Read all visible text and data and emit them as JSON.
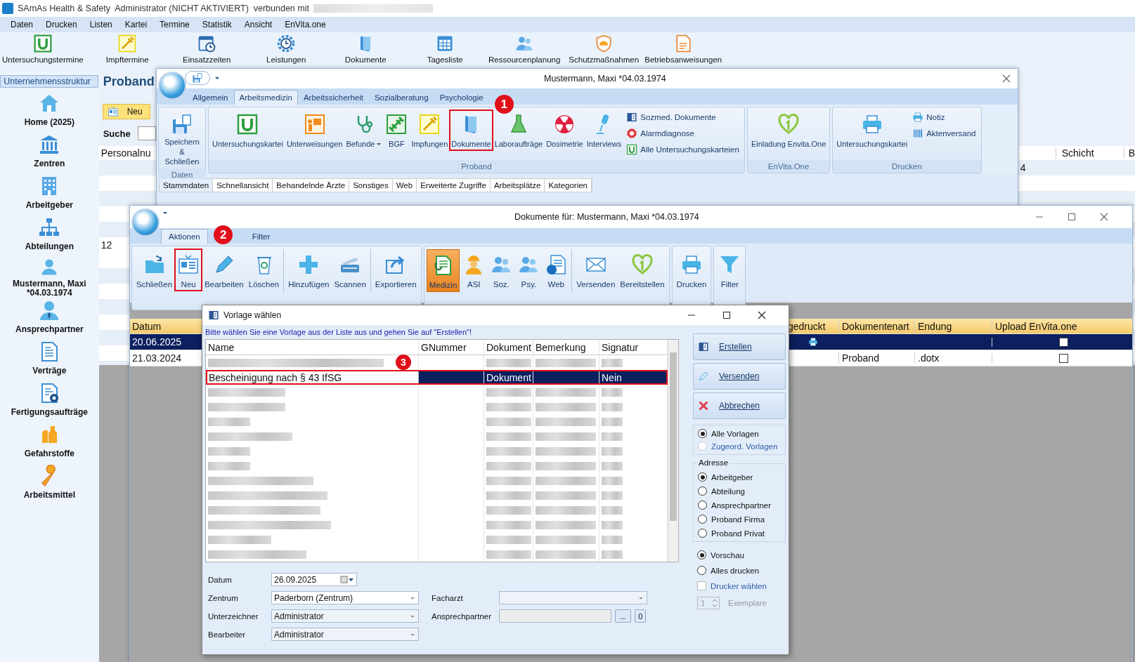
{
  "app": {
    "title": "SAmAs Health & Safety  Administrator (NICHT AKTIVIERT)  verbunden mit",
    "menu": [
      "Daten",
      "Drucken",
      "Listen",
      "Kartei",
      "Termine",
      "Statistik",
      "Ansicht",
      "EnVita.one"
    ],
    "toolbar": [
      "Untersuchungstermine",
      "Impftermine",
      "Einsatzzeiten",
      "Leistungen",
      "Dokumente",
      "Tagesliste",
      "Ressourcenplanung",
      "Schutzmaßnahmen",
      "Betriebsanweisungen"
    ]
  },
  "sidebar": {
    "header": "Unternehmensstruktur",
    "items": [
      "Home (2025)",
      "Zentren",
      "Arbeitgeber",
      "Abteilungen",
      "Mustermann, Maxi *04.03.1974",
      "Ansprechpartner",
      "Verträge",
      "Fertigungsaufträge",
      "Gefahrstoffe",
      "Arbeitsmittel"
    ]
  },
  "proband": {
    "title": "Proband",
    "new_button": "Neu",
    "search_label": "Suche",
    "columns": [
      "Personalnu",
      "Schicht",
      "B"
    ],
    "rows": [
      {
        "column_3": "4"
      },
      {},
      {},
      {},
      {},
      {
        "personalnummer": "12"
      }
    ]
  },
  "window1": {
    "title": "Mustermann, Maxi *04.03.1974",
    "tabs": [
      {
        "label": "Allgemein",
        "selected": false
      },
      {
        "label": "Arbeitsmedizin",
        "selected": true
      },
      {
        "label": "Arbeitssicherheit",
        "selected": false
      },
      {
        "label": "Sozialberatung",
        "selected": false
      },
      {
        "label": "Psychologie",
        "selected": false
      }
    ],
    "groups": [
      {
        "label": "Daten",
        "items": [
          {
            "label": "Speichern & Schließen",
            "kind": "large",
            "marked": false
          }
        ]
      },
      {
        "label": "Proband",
        "items": [
          {
            "label": "Untersuchungskartei",
            "kind": "large",
            "marked": false
          },
          {
            "label": "Unterweisungen",
            "kind": "large",
            "marked": false
          },
          {
            "label": "Befunde",
            "kind": "dropdown",
            "marked": false
          },
          {
            "label": "BGF",
            "kind": "large",
            "marked": false
          },
          {
            "label": "Impfungen",
            "kind": "large",
            "marked": false
          },
          {
            "label": "Dokumente",
            "kind": "large",
            "marked": true,
            "callout": "1"
          },
          {
            "label": "Laboraufträge",
            "kind": "large",
            "marked": false
          },
          {
            "label": "Dosimetrie",
            "kind": "large",
            "marked": false
          },
          {
            "label": "Interviews",
            "kind": "large",
            "marked": false
          },
          {
            "label": "Sozmed. Dokumente",
            "kind": "small",
            "marked": false
          },
          {
            "label": "Alarmdiagnose",
            "kind": "small",
            "marked": false
          },
          {
            "label": "Alle Untersuchungskarteien",
            "kind": "small",
            "marked": false
          }
        ]
      },
      {
        "label": "EnVita.One",
        "items": [
          {
            "label": "Einladung Envita.One",
            "kind": "large",
            "marked": false
          }
        ]
      },
      {
        "label": "Drucken",
        "items": [
          {
            "label": "Untersuchungskartei",
            "kind": "large",
            "marked": false
          },
          {
            "label": "Notiz",
            "kind": "small",
            "marked": false
          },
          {
            "label": "Aktenversand",
            "kind": "small",
            "marked": false
          }
        ]
      }
    ],
    "subtabs": [
      {
        "label": "Stammdaten",
        "selected": true
      },
      {
        "label": "Schnellansicht",
        "selected": false
      },
      {
        "label": "Behandelnde Ärzte",
        "selected": false
      },
      {
        "label": "Sonstiges",
        "selected": false
      },
      {
        "label": "Web",
        "selected": false
      },
      {
        "label": "Erweiterte Zugriffe",
        "selected": false
      },
      {
        "label": "Arbeitsplätze",
        "selected": false
      },
      {
        "label": "Kategorien",
        "selected": false
      }
    ]
  },
  "window2": {
    "title": "Dokumente für: Mustermann, Maxi *04.03.1974",
    "tabs": [
      {
        "label": "Aktionen",
        "selected": true
      },
      {
        "label": "Filter",
        "selected": false
      }
    ],
    "ribbon": [
      {
        "sections": [
          [
            {
              "label": "Schließen",
              "selected": false,
              "marked": false
            },
            {
              "label": "Neu",
              "selected": false,
              "marked": true,
              "callout": "2"
            },
            {
              "label": "Bearbeiten",
              "selected": false,
              "marked": false
            },
            {
              "label": "Löschen",
              "selected": false,
              "marked": false
            }
          ],
          [
            {
              "label": "Hinzufügen",
              "selected": false,
              "marked": false
            },
            {
              "label": "Scannen",
              "selected": false,
              "marked": false
            }
          ],
          [
            {
              "label": "Exportieren",
              "selected": false,
              "marked": false
            }
          ]
        ]
      },
      {
        "sections": [
          [
            {
              "label": "Medizin",
              "selected": true,
              "marked": false
            },
            {
              "label": "ASI",
              "selected": false,
              "marked": false
            },
            {
              "label": "Soz.",
              "selected": false,
              "marked": false
            },
            {
              "label": "Psy.",
              "selected": false,
              "marked": false
            },
            {
              "label": "Web",
              "selected": false,
              "marked": false
            }
          ],
          [
            {
              "label": "Versenden",
              "selected": false,
              "marked": false
            },
            {
              "label": "Bereitstellen",
              "selected": false,
              "marked": false
            }
          ]
        ]
      },
      {
        "sections": [
          [
            {
              "label": "Drucken",
              "selected": false,
              "marked": false
            }
          ]
        ]
      },
      {
        "sections": [
          [
            {
              "label": "Filter",
              "selected": false,
              "marked": false
            }
          ]
        ]
      }
    ],
    "table": {
      "columns": [
        "Datum",
        "gedruckt",
        "Dokumentenart",
        "Endung",
        "Upload EnVita.one"
      ],
      "rows": [
        {
          "datum": "20.06.2025",
          "printed": true,
          "upload": false,
          "selected": true
        },
        {
          "datum": "21.03.2024",
          "printed": false,
          "dokumentenart": "Proband",
          "endung": ".dotx",
          "upload": false,
          "selected": false
        }
      ]
    }
  },
  "dialog": {
    "title": "Vorlage wählen",
    "instruction": "Bitte wählen Sie eine Vorlage aus der Liste aus und gehen Sie auf \"Erstellen\"!",
    "columns": [
      "Name",
      "GNummer",
      "Dokument",
      "Bemerkung",
      "Signatur"
    ],
    "rows": [
      {
        "blurred": true,
        "selected": false,
        "marked": false
      },
      {
        "name": "Bescheinigung nach § 43 IfSG",
        "dokument": "Dokument",
        "signatur": "Nein",
        "blurred": false,
        "selected": true,
        "marked": true,
        "callout": "3"
      },
      {
        "blurred": true,
        "selected": false,
        "marked": false
      },
      {
        "blurred": true,
        "selected": false,
        "marked": false
      },
      {
        "blurred": true,
        "selected": false,
        "marked": false
      },
      {
        "blurred": true,
        "selected": false,
        "marked": false
      },
      {
        "blurred": true,
        "selected": false,
        "marked": false
      },
      {
        "blurred": true,
        "selected": false,
        "marked": false
      },
      {
        "blurred": true,
        "selected": false,
        "marked": false
      },
      {
        "blurred": true,
        "selected": false,
        "marked": false
      },
      {
        "blurred": true,
        "selected": false,
        "marked": false
      },
      {
        "blurred": true,
        "selected": false,
        "marked": false
      },
      {
        "blurred": true,
        "selected": false,
        "marked": false
      },
      {
        "blurred": true,
        "selected": false,
        "marked": false
      }
    ],
    "buttons": [
      "Erstellen",
      "Versenden",
      "Abbrechen"
    ],
    "scope": [
      {
        "label": "Alle Vorlagen",
        "selected": true,
        "disabled": false
      },
      {
        "label": "Zugeord. Vorlagen",
        "selected": false,
        "disabled": true
      }
    ],
    "address": {
      "label": "Adresse",
      "options": [
        {
          "label": "Arbeitgeber",
          "selected": true
        },
        {
          "label": "Abteilung",
          "selected": false
        },
        {
          "label": "Ansprechpartner",
          "selected": false
        },
        {
          "label": "Proband Firma",
          "selected": false
        },
        {
          "label": "Proband Privat",
          "selected": false
        }
      ]
    },
    "output": [
      {
        "label": "Vorschau",
        "selected": true
      },
      {
        "label": "Alles drucken",
        "selected": false
      }
    ],
    "printer_choice": {
      "label": "Drucker wählen",
      "checked": false
    },
    "copies": {
      "value": "1",
      "label": "Exemplare",
      "disabled": true
    },
    "fields_left": [
      {
        "label": "Datum",
        "value": "26.09.2025",
        "kind": "date",
        "disabled": false
      },
      {
        "label": "Zentrum",
        "value": "Paderborn (Zentrum)",
        "kind": "combo",
        "disabled": false
      },
      {
        "label": "Unterzeichner",
        "value": "Administrator",
        "kind": "combo",
        "disabled": true
      },
      {
        "label": "Bearbeiter",
        "value": "Administrator",
        "kind": "combo",
        "disabled": true
      }
    ],
    "fields_right": [
      {
        "label": "Facharzt",
        "kind": "combo",
        "disabled": true
      },
      {
        "label": "Ansprechpartner",
        "kind": "picker",
        "disabled": true,
        "button": "...",
        "count": "0"
      }
    ]
  }
}
